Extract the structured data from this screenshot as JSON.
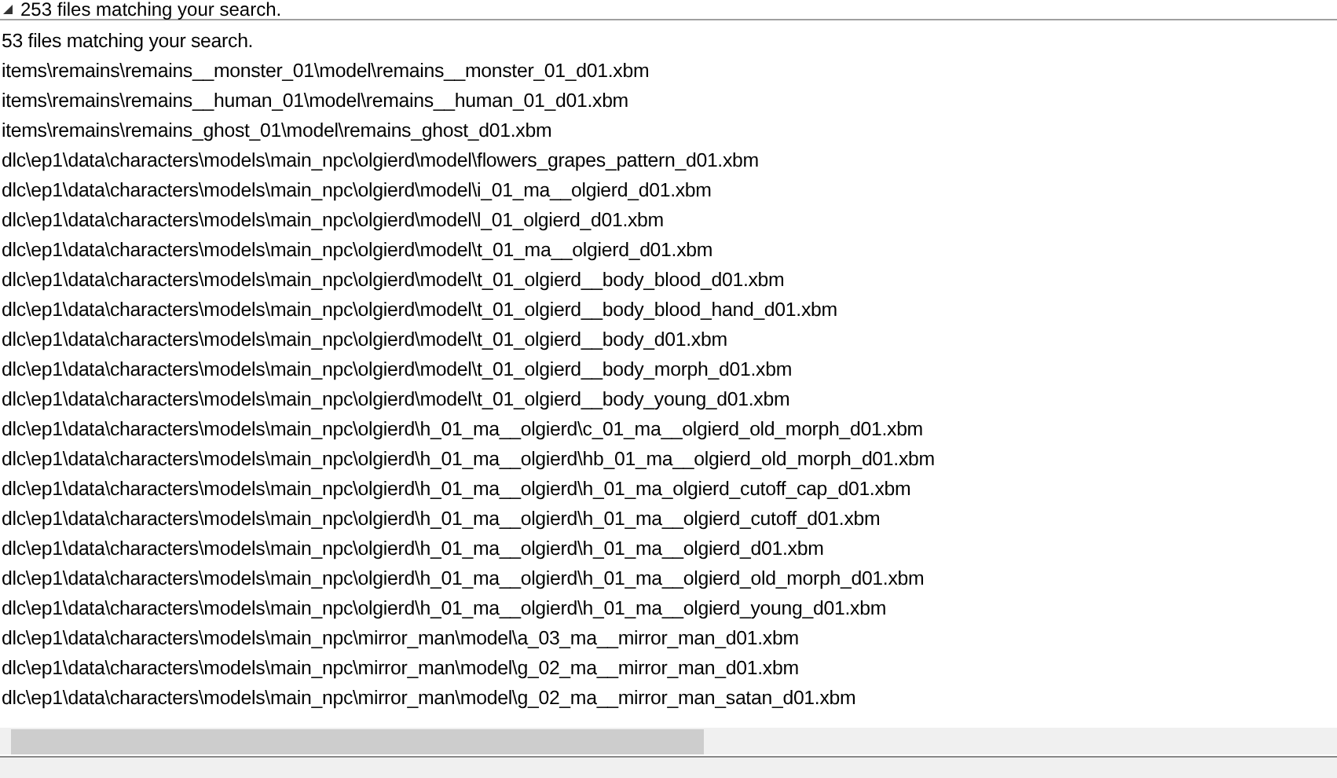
{
  "group_header": {
    "label": "253 files matching your search.",
    "expanded": true
  },
  "summary": "53 files matching your search.",
  "results": [
    "items\\remains\\remains__monster_01\\model\\remains__monster_01_d01.xbm",
    "items\\remains\\remains__human_01\\model\\remains__human_01_d01.xbm",
    "items\\remains\\remains_ghost_01\\model\\remains_ghost_d01.xbm",
    "dlc\\ep1\\data\\characters\\models\\main_npc\\olgierd\\model\\flowers_grapes_pattern_d01.xbm",
    "dlc\\ep1\\data\\characters\\models\\main_npc\\olgierd\\model\\i_01_ma__olgierd_d01.xbm",
    "dlc\\ep1\\data\\characters\\models\\main_npc\\olgierd\\model\\l_01_olgierd_d01.xbm",
    "dlc\\ep1\\data\\characters\\models\\main_npc\\olgierd\\model\\t_01_ma__olgierd_d01.xbm",
    "dlc\\ep1\\data\\characters\\models\\main_npc\\olgierd\\model\\t_01_olgierd__body_blood_d01.xbm",
    "dlc\\ep1\\data\\characters\\models\\main_npc\\olgierd\\model\\t_01_olgierd__body_blood_hand_d01.xbm",
    "dlc\\ep1\\data\\characters\\models\\main_npc\\olgierd\\model\\t_01_olgierd__body_d01.xbm",
    "dlc\\ep1\\data\\characters\\models\\main_npc\\olgierd\\model\\t_01_olgierd__body_morph_d01.xbm",
    "dlc\\ep1\\data\\characters\\models\\main_npc\\olgierd\\model\\t_01_olgierd__body_young_d01.xbm",
    "dlc\\ep1\\data\\characters\\models\\main_npc\\olgierd\\h_01_ma__olgierd\\c_01_ma__olgierd_old_morph_d01.xbm",
    "dlc\\ep1\\data\\characters\\models\\main_npc\\olgierd\\h_01_ma__olgierd\\hb_01_ma__olgierd_old_morph_d01.xbm",
    "dlc\\ep1\\data\\characters\\models\\main_npc\\olgierd\\h_01_ma__olgierd\\h_01_ma_olgierd_cutoff_cap_d01.xbm",
    "dlc\\ep1\\data\\characters\\models\\main_npc\\olgierd\\h_01_ma__olgierd\\h_01_ma__olgierd_cutoff_d01.xbm",
    "dlc\\ep1\\data\\characters\\models\\main_npc\\olgierd\\h_01_ma__olgierd\\h_01_ma__olgierd_d01.xbm",
    "dlc\\ep1\\data\\characters\\models\\main_npc\\olgierd\\h_01_ma__olgierd\\h_01_ma__olgierd_old_morph_d01.xbm",
    "dlc\\ep1\\data\\characters\\models\\main_npc\\olgierd\\h_01_ma__olgierd\\h_01_ma__olgierd_young_d01.xbm",
    "dlc\\ep1\\data\\characters\\models\\main_npc\\mirror_man\\model\\a_03_ma__mirror_man_d01.xbm",
    "dlc\\ep1\\data\\characters\\models\\main_npc\\mirror_man\\model\\g_02_ma__mirror_man_d01.xbm",
    "dlc\\ep1\\data\\characters\\models\\main_npc\\mirror_man\\model\\g_02_ma__mirror_man_satan_d01.xbm"
  ]
}
